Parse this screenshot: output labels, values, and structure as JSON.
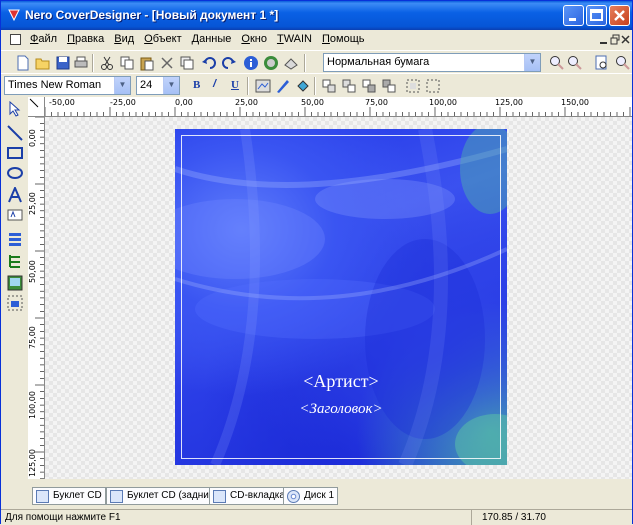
{
  "window": {
    "title": "Nero CoverDesigner - [Новый документ 1 *]",
    "accent": "#0a5ddb"
  },
  "menu": {
    "items": [
      "Файл",
      "Правка",
      "Вид",
      "Объект",
      "Данные",
      "Окно",
      "TWAIN",
      "Помощь"
    ]
  },
  "toolbar": {
    "paper_type": "Нормальная бумага",
    "font_name": "Times New Roman",
    "font_size": "24",
    "bold_label": "B",
    "italic_label": "/",
    "underline_label": "U"
  },
  "ruler": {
    "h_labels": [
      "-50,00",
      "-25,00",
      "0,00",
      "25,00",
      "50,00",
      "75,00",
      "100,00",
      "125,00",
      "150,00"
    ],
    "v_labels": [
      "0,00",
      "25,00",
      "50,00",
      "75,00",
      "100,00",
      "125,00"
    ]
  },
  "cover": {
    "artist": "<Артист>",
    "title": "<Заголовок>"
  },
  "tabs": [
    "Буклет CD",
    "Буклет CD (задний)",
    "CD-вкладка",
    "Диск 1"
  ],
  "status": {
    "hint": "Для помощи нажмите F1",
    "coords": "170.85 / 31.70"
  }
}
